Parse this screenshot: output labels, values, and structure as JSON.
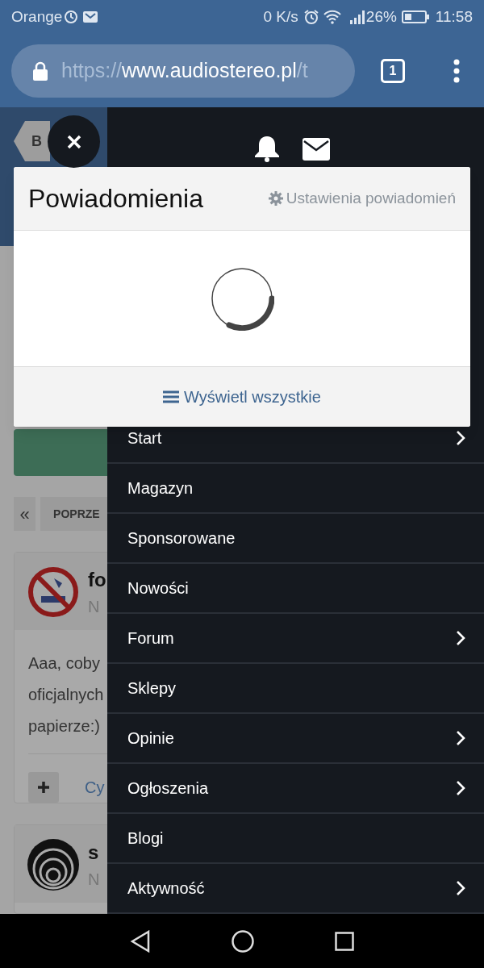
{
  "status_bar": {
    "carrier": "Orange",
    "speed": "0 K/s",
    "battery": "26%",
    "time": "11:58"
  },
  "browser": {
    "url_scheme": "https://",
    "url_host": "www.audiostereo.pl",
    "url_rest": "/t",
    "tab_count": "1"
  },
  "background_page": {
    "breadcrumb": "B",
    "pager_first": "«",
    "pager_label": "POPRZE",
    "posts": [
      {
        "author": "fo",
        "meta": "N",
        "lines": [
          "Aaa, coby",
          "oficjalnych",
          "papierze:)"
        ],
        "quote": "Cy"
      },
      {
        "author": "s",
        "meta": "N"
      }
    ]
  },
  "popup": {
    "title": "Powiadomienia",
    "settings_link": "Ustawienia powiadomień",
    "view_all": "Wyświetl wszystkie"
  },
  "menu": {
    "items": [
      {
        "label": "Start",
        "has_submenu": true
      },
      {
        "label": "Magazyn",
        "has_submenu": false
      },
      {
        "label": "Sponsorowane",
        "has_submenu": false
      },
      {
        "label": "Nowości",
        "has_submenu": false
      },
      {
        "label": "Forum",
        "has_submenu": true
      },
      {
        "label": "Sklepy",
        "has_submenu": false
      },
      {
        "label": "Opinie",
        "has_submenu": true
      },
      {
        "label": "Ogłoszenia",
        "has_submenu": true
      },
      {
        "label": "Blogi",
        "has_submenu": false
      },
      {
        "label": "Aktywność",
        "has_submenu": true
      }
    ]
  }
}
